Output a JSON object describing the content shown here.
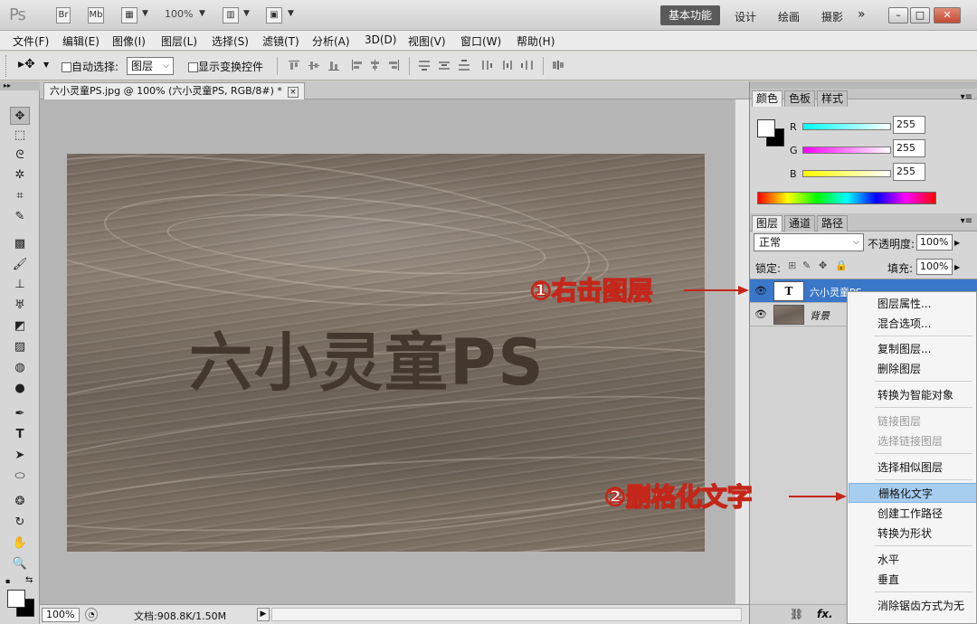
{
  "titlebar": {
    "logo": "Ps",
    "bridge_btn": "Br",
    "minibridge_btn": "Mb",
    "zoom": "100%",
    "workspace_active": "基本功能",
    "workspaces": [
      "设计",
      "绘画",
      "摄影"
    ],
    "more": "»",
    "win_minimize": "–",
    "win_restore": "□",
    "win_close": "✕"
  },
  "menubar": {
    "items": [
      "文件(F)",
      "编辑(E)",
      "图像(I)",
      "图层(L)",
      "选择(S)",
      "滤镜(T)",
      "分析(A)",
      "3D(D)",
      "视图(V)",
      "窗口(W)",
      "帮助(H)"
    ]
  },
  "options": {
    "auto_select_label": "自动选择:",
    "auto_select_value": "图层",
    "show_transform_label": "显示变换控件"
  },
  "document": {
    "tab_title": "六小灵童PS.jpg @ 100% (六小灵童PS, RGB/8#) *",
    "close": "×",
    "canvas_text": "六小灵童PS"
  },
  "statusbar": {
    "zoom": "100%",
    "doc_info": "文档:908.8K/1.50M"
  },
  "color_panel": {
    "tabs": [
      "颜色",
      "色板",
      "样式"
    ],
    "r_label": "R",
    "g_label": "G",
    "b_label": "B",
    "r_value": "255",
    "g_value": "255",
    "b_value": "255"
  },
  "layers_panel": {
    "tabs": [
      "图层",
      "通道",
      "路径"
    ],
    "blend_mode": "正常",
    "opacity_label": "不透明度:",
    "opacity_value": "100%",
    "lock_label": "锁定:",
    "fill_label": "填充:",
    "fill_value": "100%",
    "layers": [
      {
        "name": "六小灵童PS",
        "thumb": "T"
      },
      {
        "name": "背景"
      }
    ],
    "footer_icons": [
      "link-icon",
      "fx-icon"
    ]
  },
  "annotations": {
    "step1": "①右击图层",
    "step2": "②删格化文字"
  },
  "context_menu": {
    "items": [
      {
        "label": "图层属性...",
        "state": "normal"
      },
      {
        "label": "混合选项...",
        "state": "normal"
      },
      {
        "label": "复制图层...",
        "state": "normal"
      },
      {
        "label": "删除图层",
        "state": "normal"
      },
      {
        "label": "转换为智能对象",
        "state": "normal"
      },
      {
        "label": "链接图层",
        "state": "disabled"
      },
      {
        "label": "选择链接图层",
        "state": "disabled"
      },
      {
        "label": "选择相似图层",
        "state": "normal"
      },
      {
        "label": "栅格化文字",
        "state": "highlight"
      },
      {
        "label": "创建工作路径",
        "state": "normal"
      },
      {
        "label": "转换为形状",
        "state": "normal"
      },
      {
        "label": "水平",
        "state": "normal"
      },
      {
        "label": "垂直",
        "state": "normal"
      },
      {
        "label": "消除锯齿方式为无",
        "state": "normal"
      }
    ]
  },
  "colors": {
    "accent_selected_layer": "#3a77c9",
    "menu_highlight": "#a7cdf0",
    "annotation_red": "#c4271a"
  }
}
